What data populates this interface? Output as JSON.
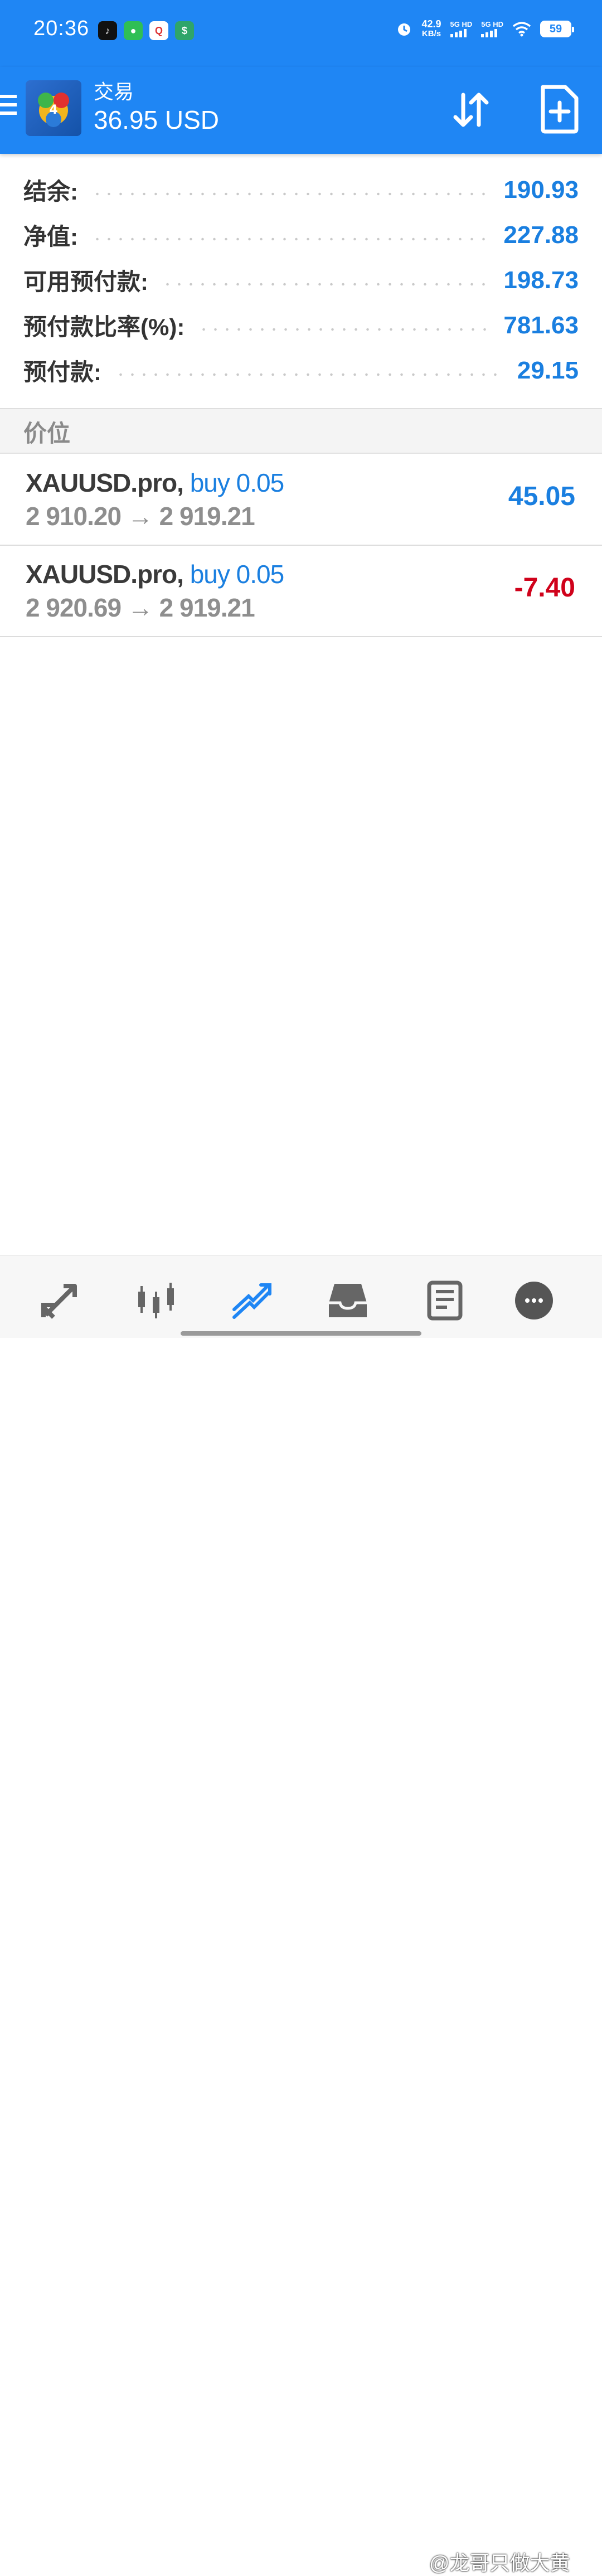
{
  "status_bar": {
    "time": "20:36",
    "speed_value": "42.9",
    "speed_unit": "KB/s",
    "sim1": "5G HD",
    "sim2": "5G HD",
    "battery": "59"
  },
  "toolbar": {
    "title": "交易",
    "subtitle": "36.95 USD"
  },
  "account": {
    "rows": [
      {
        "label": "结余:",
        "value": "190.93"
      },
      {
        "label": "净值:",
        "value": "227.88"
      },
      {
        "label": "可用预付款:",
        "value": "198.73"
      },
      {
        "label": "预付款比率(%):",
        "value": "781.63"
      },
      {
        "label": "预付款:",
        "value": "29.15"
      }
    ]
  },
  "positions_header": "价位",
  "positions": [
    {
      "symbol": "XAUUSD.pro,",
      "action": "buy 0.05",
      "prices": "2 910.20 → 2 919.21",
      "profit": "45.05"
    },
    {
      "symbol": "XAUUSD.pro,",
      "action": "buy 0.05",
      "prices": "2 920.69 → 2 919.21",
      "profit": "-7.40"
    }
  ],
  "watermark": "@龙哥只做大黄",
  "colors": {
    "primary": "#1f86f4",
    "value_blue": "#1a7fe0",
    "loss_red": "#d0021b"
  },
  "icons": {
    "nav": [
      "quotes-icon",
      "chart-icon",
      "trade-icon",
      "history-icon",
      "news-icon",
      "messages-icon"
    ]
  }
}
